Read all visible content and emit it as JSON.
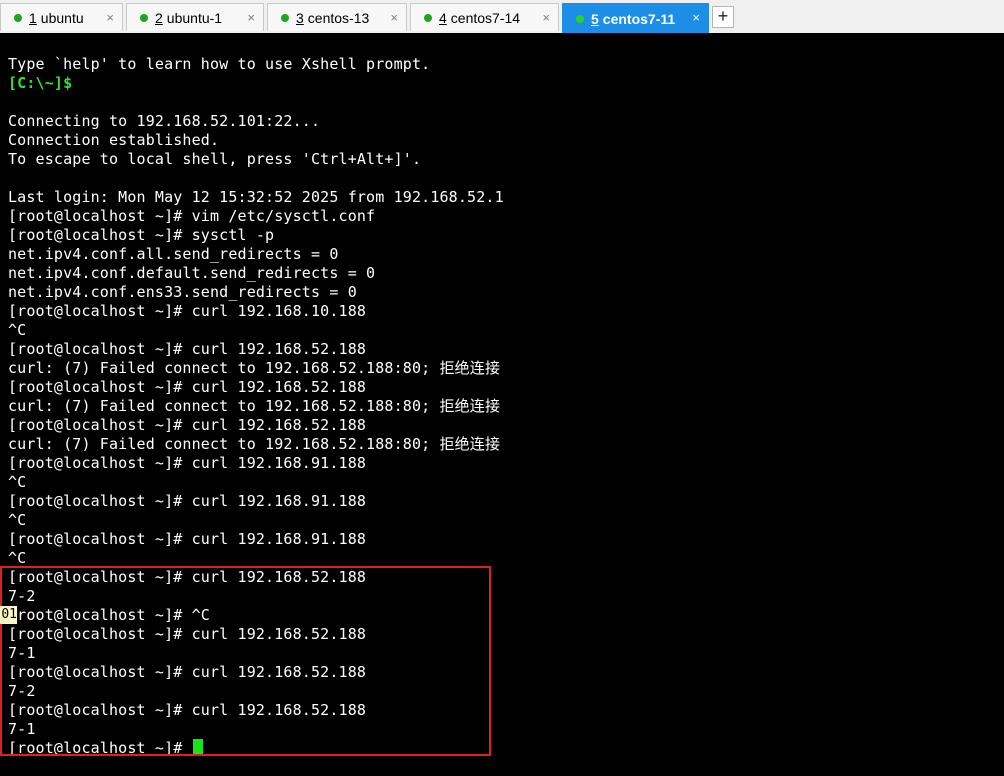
{
  "tabs": [
    {
      "num": "1",
      "label": "ubuntu",
      "close": "×"
    },
    {
      "num": "2",
      "label": "ubuntu-1",
      "close": "×"
    },
    {
      "num": "3",
      "label": "centos-13",
      "close": "×"
    },
    {
      "num": "4",
      "label": "centos7-14",
      "close": "×"
    },
    {
      "num": "5",
      "label": "centos7-11",
      "close": "×"
    }
  ],
  "add_tab_label": "+",
  "terminal": {
    "lines": [
      "Type `help' to learn how to use Xshell prompt.",
      "[C:\\~]$",
      "",
      "Connecting to 192.168.52.101:22...",
      "Connection established.",
      "To escape to local shell, press 'Ctrl+Alt+]'.",
      "",
      "Last login: Mon May 12 15:32:52 2025 from 192.168.52.1",
      "[root@localhost ~]# vim /etc/sysctl.conf",
      "[root@localhost ~]# sysctl -p",
      "net.ipv4.conf.all.send_redirects = 0",
      "net.ipv4.conf.default.send_redirects = 0",
      "net.ipv4.conf.ens33.send_redirects = 0",
      "[root@localhost ~]# curl 192.168.10.188",
      "^C",
      "[root@localhost ~]# curl 192.168.52.188",
      "curl: (7) Failed connect to 192.168.52.188:80; 拒绝连接",
      "[root@localhost ~]# curl 192.168.52.188",
      "curl: (7) Failed connect to 192.168.52.188:80; 拒绝连接",
      "[root@localhost ~]# curl 192.168.52.188",
      "curl: (7) Failed connect to 192.168.52.188:80; 拒绝连接",
      "[root@localhost ~]# curl 192.168.91.188",
      "^C",
      "[root@localhost ~]# curl 192.168.91.188",
      "^C",
      "[root@localhost ~]# curl 192.168.91.188",
      "^C",
      "[root@localhost ~]# curl 192.168.52.188",
      "7-2",
      "[root@localhost ~]# ^C",
      "[root@localhost ~]# curl 192.168.52.188",
      "7-1",
      "[root@localhost ~]# curl 192.168.52.188",
      "7-2",
      "[root@localhost ~]# curl 192.168.52.188",
      "7-1",
      "[root@localhost ~]# "
    ],
    "marker_text": "01"
  },
  "colors": {
    "terminal_bg": "#000000",
    "text": "#ffffff",
    "local_prompt": "#2ee32e",
    "cursor": "#18e418",
    "active_tab": "#1d8ee7",
    "status_dot": "#1ea51e",
    "highlight_box": "#e01f1f"
  }
}
